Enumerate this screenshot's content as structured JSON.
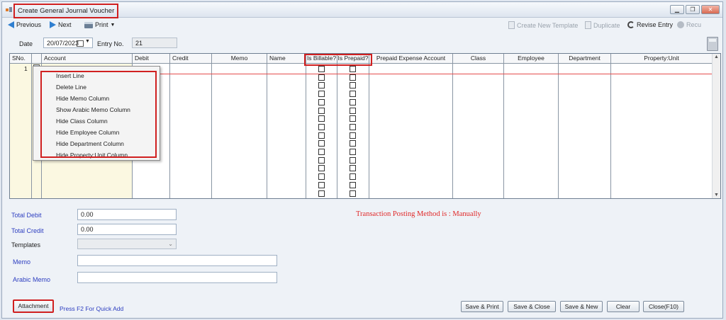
{
  "window": {
    "title": "Create General Journal Voucher"
  },
  "toolbar": {
    "previous": "Previous",
    "next": "Next",
    "print": "Print",
    "create_template": "Create New Template",
    "duplicate": "Duplicate",
    "revise_entry": "Revise Entry",
    "recall": "Recu"
  },
  "form": {
    "date_label": "Date",
    "date_value": "20/07/2023",
    "entry_no_label": "Entry No.",
    "entry_no_value": "21"
  },
  "grid": {
    "columns": [
      "SNo.",
      "Account",
      "Debit",
      "Credit",
      "Memo",
      "Name",
      "Is Billable?",
      "Is Prepaid?",
      "Prepaid Expense Account",
      "Class",
      "Employee",
      "Department",
      "Property:Unit"
    ],
    "first_row_number": "1"
  },
  "context_menu": {
    "items": [
      "Insert Line",
      "Delete Line",
      "Hide Memo Column",
      "Show Arabic Memo Column",
      "Hide Class Column",
      "Hide Employee Column",
      "Hide Department Column",
      "Hide Property:Unit Column"
    ]
  },
  "totals": {
    "debit_label": "Total Debit",
    "debit_value": "0.00",
    "credit_label": "Total Credit",
    "credit_value": "0.00",
    "templates_label": "Templates",
    "memo_label": "Memo",
    "arabic_memo_label": "Arabic Memo"
  },
  "posting_message": "Transaction Posting Method is : Manually",
  "footer": {
    "attachment": "Attachment",
    "quick_add_hint": "Press F2 For Quick Add",
    "save_print": "Save & Print",
    "save_close": "Save & Close",
    "save_new": "Save & New",
    "clear": "Clear",
    "close": "Close(F10)"
  }
}
